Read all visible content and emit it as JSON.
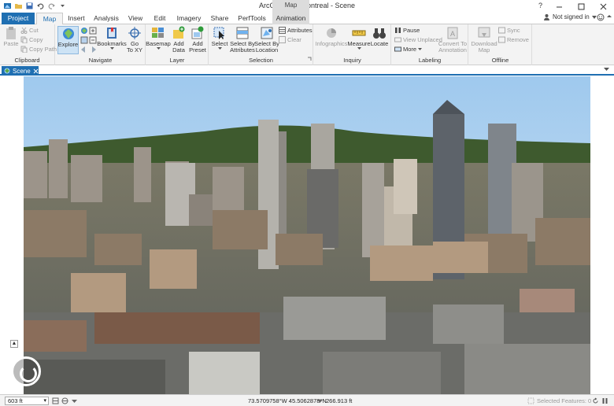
{
  "titlebar": {
    "app_title": "ArcGIS Pro - Montreal - Scene",
    "context_group": "Map",
    "help": "?"
  },
  "tabs": {
    "project": "Project",
    "items": [
      "Map",
      "Insert",
      "Analysis",
      "View",
      "Edit",
      "Imagery",
      "Share",
      "PerfTools"
    ],
    "context_tab": "Animation",
    "active": "Map",
    "signin": "Not signed in"
  },
  "ribbon": {
    "clipboard": {
      "label": "Clipboard",
      "paste": "Paste",
      "cut": "Cut",
      "copy": "Copy",
      "copy_path": "Copy Path"
    },
    "navigate": {
      "label": "Navigate",
      "explore": "Explore",
      "bookmarks": "Bookmarks",
      "go_to_xy_line1": "Go",
      "go_to_xy_line2": "To XY"
    },
    "layer": {
      "label": "Layer",
      "basemap": "Basemap",
      "add_data_line1": "Add",
      "add_data_line2": "Data",
      "add_preset_line1": "Add",
      "add_preset_line2": "Preset"
    },
    "selection": {
      "label": "Selection",
      "select": "Select",
      "select_by_attr_line1": "Select By",
      "select_by_attr_line2": "Attributes",
      "select_by_loc_line1": "Select By",
      "select_by_loc_line2": "Location",
      "attributes": "Attributes",
      "clear": "Clear"
    },
    "inquiry": {
      "label": "Inquiry",
      "infographics": "Infographics",
      "measure": "Measure",
      "locate": "Locate"
    },
    "labeling": {
      "label": "Labeling",
      "pause": "Pause",
      "view_unplaced": "View Unplaced",
      "more": "More",
      "convert_line1": "Convert To",
      "convert_line2": "Annotation"
    },
    "offline": {
      "label": "Offline",
      "download_line1": "Download",
      "download_line2": "Map",
      "sync": "Sync",
      "remove": "Remove"
    }
  },
  "view": {
    "tab_label": "Scene"
  },
  "status": {
    "scale": "603 ft",
    "coordinates": "73.5709758°W 45.5062878°N",
    "elevation": "266.913 ft",
    "selected_features": "Selected Features: 0"
  }
}
